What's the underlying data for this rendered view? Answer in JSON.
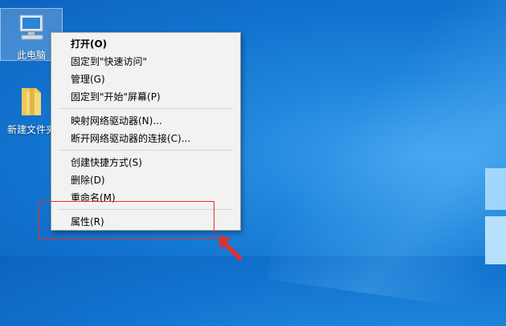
{
  "desktop": {
    "icons": [
      {
        "label": "此电脑",
        "icon": "computer-icon"
      },
      {
        "label": "新建文件夹",
        "icon": "folder-icon"
      }
    ]
  },
  "context_menu": {
    "items": [
      {
        "label": "打开(O)",
        "bold": true
      },
      {
        "label": "固定到\"快速访问\""
      },
      {
        "label": "管理(G)"
      },
      {
        "label": "固定到\"开始\"屏幕(P)"
      },
      {
        "label": "映射网络驱动器(N)..."
      },
      {
        "label": "断开网络驱动器的连接(C)..."
      },
      {
        "label": "创建快捷方式(S)"
      },
      {
        "label": "删除(D)"
      },
      {
        "label": "重命名(M)"
      },
      {
        "label": "属性(R)"
      }
    ]
  },
  "colors": {
    "highlight": "#e0302e",
    "desktop_blue": "#1274cf"
  }
}
